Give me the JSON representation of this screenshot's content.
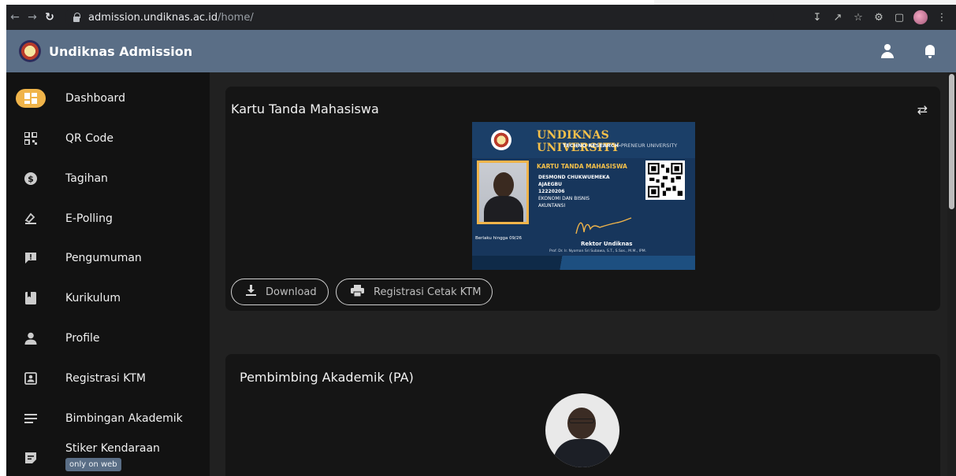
{
  "browser": {
    "url_host": "admission.undiknas.ac.id",
    "url_path": "/home/"
  },
  "header": {
    "title": "Undiknas Admission"
  },
  "sidebar": {
    "items": [
      {
        "label": "Dashboard",
        "icon": "dashboard-icon",
        "active": true
      },
      {
        "label": "QR Code",
        "icon": "qr-code-icon"
      },
      {
        "label": "Tagihan",
        "icon": "dollar-icon"
      },
      {
        "label": "E-Polling",
        "icon": "vote-icon"
      },
      {
        "label": "Pengumuman",
        "icon": "announcement-icon"
      },
      {
        "label": "Kurikulum",
        "icon": "book-icon"
      },
      {
        "label": "Profile",
        "icon": "person-icon"
      },
      {
        "label": "Registrasi KTM",
        "icon": "id-card-icon"
      },
      {
        "label": "Bimbingan Akademik",
        "icon": "menu-lines-icon"
      },
      {
        "label": "Stiker Kendaraan",
        "icon": "sticker-icon",
        "badge": "only on web"
      }
    ]
  },
  "ktm_card": {
    "title": "Kartu Tanda Mahasiswa",
    "card": {
      "university": "UNDIKNAS UNIVERSITY",
      "tagline_bold": "TECHNO RESEARCH-",
      "tagline_rest": "PRENEUR UNIVERSITY",
      "heading": "KARTU TANDA MAHASISWA",
      "name_line1": "DESMOND CHUKWUEMEKA",
      "name_line2": "AJAEGBU",
      "nim": "12220206",
      "faculty": "EKONOMI DAN BISNIS",
      "program": "AKUNTANSI",
      "valid_until": "Berlaku hingga 09/26",
      "signer_title": "Rektor Undiknas",
      "signer_name": "Prof. Dr. Ir. Nyoman Sri Subawa, S.T., S.Sos., M.M., IPM."
    },
    "buttons": {
      "download": "Download",
      "register_print": "Registrasi Cetak KTM"
    }
  },
  "pa_card": {
    "title": "Pembimbing Akademik (PA)"
  },
  "colors": {
    "header_bg": "#5a6e86",
    "sidebar_bg": "#121212",
    "main_bg": "#212121",
    "card_bg": "#151515",
    "accent": "#f0b44a"
  }
}
